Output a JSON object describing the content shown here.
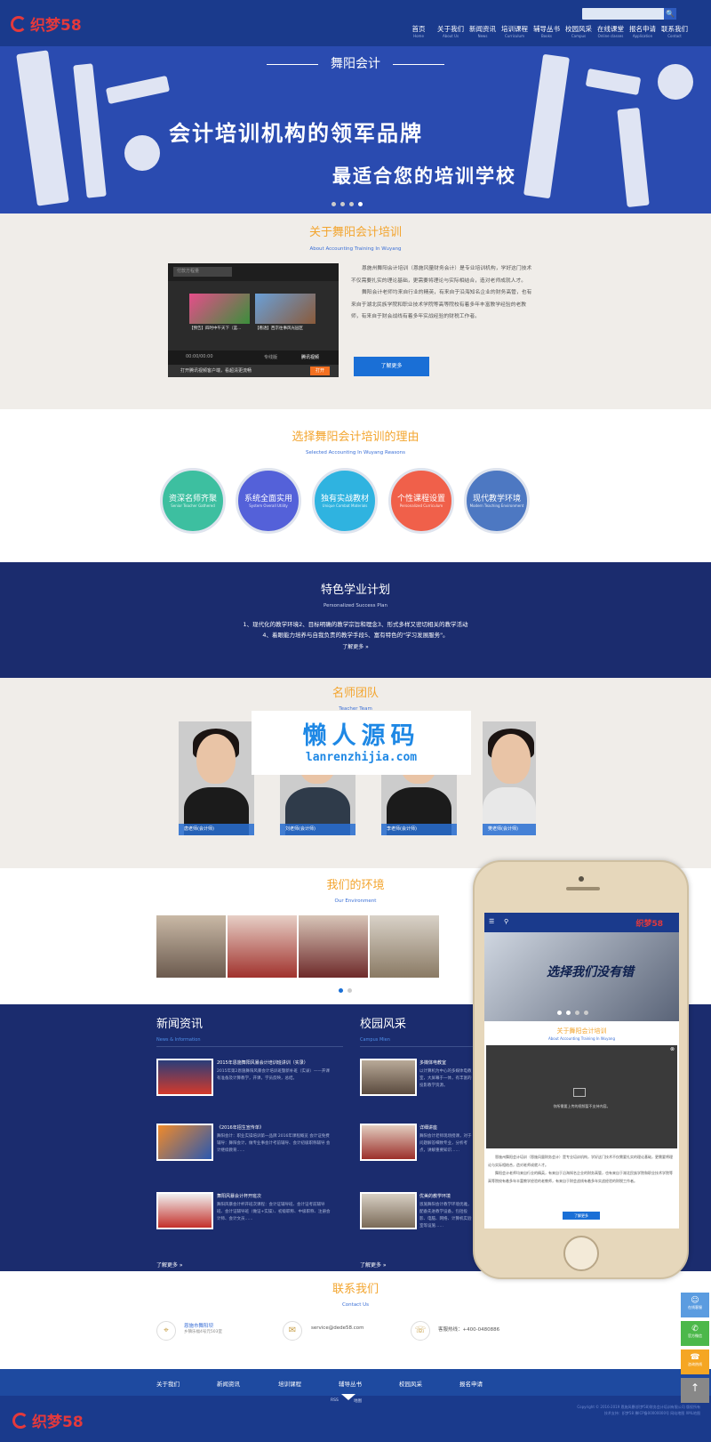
{
  "header": {
    "logo": "织梦58",
    "search_placeholder": "",
    "search_icon": "🔍",
    "nav": [
      {
        "cn": "首页",
        "en": "Home"
      },
      {
        "cn": "关于我们",
        "en": "About Us"
      },
      {
        "cn": "新闻资讯",
        "en": "News"
      },
      {
        "cn": "培训课程",
        "en": "Curriculum"
      },
      {
        "cn": "辅导丛书",
        "en": "Books"
      },
      {
        "cn": "校园风采",
        "en": "Campus"
      },
      {
        "cn": "在线课堂",
        "en": "Online classes"
      },
      {
        "cn": "报名申请",
        "en": "Application"
      },
      {
        "cn": "联系我们",
        "en": "Contact"
      }
    ]
  },
  "banner": {
    "brand": "舞阳会计",
    "line1": "会计培训机构的领军品牌",
    "line2": "最适合您的培训学校",
    "dots": 4,
    "active_dot": 3
  },
  "about": {
    "title": "关于舞阳会计培训",
    "subtitle": "About Accounting Training In Wuyang",
    "p1": "恩施州舞阳会计培训（恩施风量财务会计）是专业培训机构，学好这门技术不仅需要扎实的理论基础，更需要将理论与实际相结合，造对老师成就人才。",
    "p2": "舞阳会计老师均来自行业的精英，有来自于沿海知名企业的财务高管，也有来自于湖北民族学院和职业技术学院等高等院校有着多年丰富教学经验的老教师，有来自于财会战线有着多年实战经验的财税工作者。",
    "more": "了解更多",
    "video": {
      "search": "付款方程量",
      "cap1": "【预告】四时中午天下（蓝...",
      "cap2": "【看透】西京往事风光园区",
      "time": "00:00/00:00",
      "mode": "专线版",
      "btn": "腾讯视频",
      "promo": "打开腾讯视频客户端，看超清更流畅",
      "open": "打开"
    }
  },
  "reasons": {
    "title": "选择舞阳会计培训的理由",
    "subtitle": "Selected Accounting In Wuyang Reasons",
    "items": [
      {
        "t": "资深名师齐聚",
        "e": "Senior Teacher Gathered",
        "c": "#3dbfa0"
      },
      {
        "t": "系统全面实用",
        "e": "System Overall Utility",
        "c": "#5461d9"
      },
      {
        "t": "独有实战教材",
        "e": "Unique Combat Materials",
        "c": "#2fb3e0"
      },
      {
        "t": "个性课程设置",
        "e": "Personalized Curriculum",
        "c": "#f0604a"
      },
      {
        "t": "现代教学环境",
        "e": "Modern Teaching Environment",
        "c": "#4d78c2"
      }
    ]
  },
  "plan": {
    "title": "特色学业计划",
    "subtitle": "Personalized Success Plan",
    "line1": "1、现代化的教学环境2、目标明确的教学宗旨和理念3、形式多样又密切相关的教学活动",
    "line2": "4、着眼能力培养与自我负责的教学手段5、富有特色的\"学习发展服务\"。",
    "more": "了解更多 »"
  },
  "team": {
    "title": "名师团队",
    "subtitle": "Teacher Team",
    "members": [
      {
        "name": "唐老师(会计师)",
        "bg": "#c7232a"
      },
      {
        "name": "刘老师(会计师)",
        "bg": "#d9d9d9"
      },
      {
        "name": "李老师(会计师)",
        "bg": "#e6e6e6"
      },
      {
        "name": "樊老师(会计师)",
        "bg": "#1e6fe0"
      }
    ]
  },
  "watermark": {
    "line1": "懒人源码",
    "line2": "lanrenzhijia.com"
  },
  "environment": {
    "title": "我们的环境",
    "subtitle": "Our Environment"
  },
  "news": {
    "title": "新闻资讯",
    "subtitle": "News & Information",
    "items": [
      {
        "t": "2015年恩施舞阳风暴会计培训班讲训（实录）",
        "d": "2015年第2恩施舞阳风暴会计培训班暨新补班（实录）——开课有准备及计算教学，开课，学员反映，总结。"
      },
      {
        "t": "《2016年招生宣传单》",
        "d": "舞阳会计：职业实操培训第一品牌 2016年课程概览 会计证免费辅导：舞阳会计，做专业事会计考前辅导、会计初级职称辅导 会计继续教育……"
      },
      {
        "t": "舞阳风暴会计杯开班次",
        "d": "舞阳风暴会计杯开班次课程：会计证辅导班、会计证考前辅导班、会计证辅导班（做证+实操）、初级职称、中级职称、注册会计师、会计文员……"
      }
    ],
    "more": "了解更多 »"
  },
  "campus": {
    "title": "校园风采",
    "subtitle": "Campus Mien",
    "items": [
      {
        "t": "多媒体电教室",
        "d": "以计算机为中心的多媒体电教室，大屏幕于一体，有丰富的投影教学资源。"
      },
      {
        "t": "详细讲座",
        "d": "舞阳会计老师现场授课，对于问题解答细致专业，分析考点，讲解重要知识……"
      },
      {
        "t": "优美的教学环境",
        "d": "恩施舞阳会计教学环境优雅，配备先进教学设备，包括投影、电脑、网络、计算机实验室等设施……"
      }
    ],
    "more": "了解更多 »"
  },
  "contact": {
    "title": "联系我们",
    "subtitle": "Contact Us",
    "address": "恩施市舞阳坝",
    "address2": "乡镇乐福4号元503室",
    "email": "service@dede58.com",
    "phone": "客服热线：+400-0480886"
  },
  "footer_nav": [
    "关于我们",
    "新闻资讯",
    "培训课程",
    "辅导丛书",
    "校园风采",
    "报名申请"
  ],
  "footer": {
    "tab1": "RSS",
    "tab2": "地图",
    "logo": "织梦58",
    "copy1": "Copyright © 2016-2019 恩施风暴(织梦58)财务会计培训有限公司 版权所有",
    "copy2": "技术支持：织梦58 豫ICP备00000000号 网站地图 XML地图"
  },
  "phone": {
    "logo": "织梦58",
    "banner": "选择我们没有错",
    "about_title": "关于舞阳会计培训",
    "about_sub": "About Accounting Training In Wuyang",
    "video_msg": "你所需要上传的视频暂不支持内容。",
    "p1": "恩施州舞阳会计培训（恩施风量财务会计）是专业培训机构，学好这门技术不仅需要扎实的理论基础，更需要将理论与实际相结合，造对老师成就人才。",
    "p2": "舞阳会计老师均来自行业的精英，有来自于沿海知名企业的财务高管，也有来自于湖北民族学院和职业技术学院等高等院校有着多年丰富教学经验的老教师，有来自于财会战线有着多年实战经验的财税工作者。",
    "more": "了解更多"
  },
  "side": [
    {
      "label": "在线客服",
      "color": "#5b9ce0"
    },
    {
      "label": "官方微信",
      "color": "#4cb84a"
    },
    {
      "label": "咨询热线",
      "color": "#f5a623"
    },
    {
      "label": "",
      "color": "#888888"
    }
  ],
  "colors": {
    "navy": "#1b2c6e",
    "blue": "#1a3a8c",
    "accent": "#f3a52f",
    "link": "#3a6fd6"
  }
}
